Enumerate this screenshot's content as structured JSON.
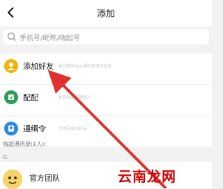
{
  "header": {
    "title": "添加"
  },
  "search": {
    "placeholder": "手机号/昵称/嗨起号"
  },
  "rows": [
    {
      "label": "添加好友",
      "sub": "通过微信/qq/通讯录添加好友"
    },
    {
      "label": "配配",
      "sub": "发现身边有趣的人"
    },
    {
      "label": "通缉令",
      "sub": "寻找失联的好友"
    }
  ],
  "section": {
    "label": "嗨起通讯录(1人):"
  },
  "group": {
    "letter": "G"
  },
  "contact": {
    "name": "官方团队"
  },
  "watermark": {
    "text": "云南龙网"
  },
  "colors": {
    "accent_yellow": "#f5b400",
    "accent_green": "#2e9d57",
    "accent_blue": "#2b88e7",
    "arrow_red": "#e03030"
  }
}
